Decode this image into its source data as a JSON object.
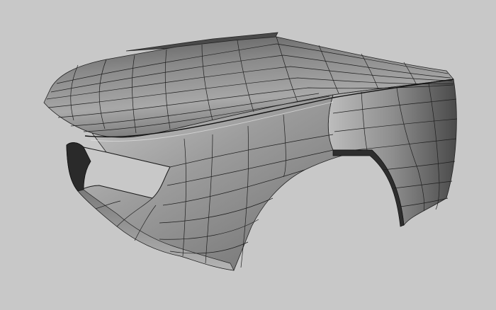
{
  "viewport": {
    "background_color": "#c8c8c8",
    "mesh_color": "#1e1e1e",
    "surface_light": "#d6d6d6",
    "surface_mid": "#9a9a9a",
    "surface_dark": "#3c3c3c",
    "model_name": "car-front-body-wireframe-mesh"
  }
}
